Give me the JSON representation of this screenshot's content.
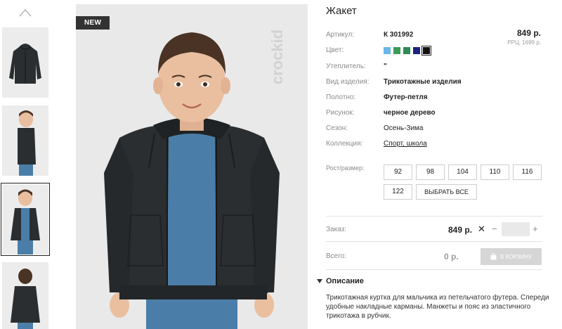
{
  "product": {
    "title": "Жакет",
    "badge": "NEW",
    "watermark": "crockid",
    "price": "849 р.",
    "rrp": "РРЦ: 1699 р."
  },
  "attributes": [
    {
      "label": "Артикул:",
      "value": "К 301992"
    },
    {
      "label": "Цвет:",
      "value": ""
    },
    {
      "label": "Утеплитель:",
      "value": "\""
    },
    {
      "label": "Вид изделия:",
      "value": "Трикотажные изделия"
    },
    {
      "label": "Полотно:",
      "value": "Футер-петля"
    },
    {
      "label": "Рисунок:",
      "value": "черное дерево"
    },
    {
      "label": "Сезон:",
      "value": "Осень-Зима"
    },
    {
      "label": "Коллекция:",
      "value": "Спорт, школа"
    }
  ],
  "swatch_colors": [
    "#6ab7e8",
    "#3d9a58",
    "#2f8a55",
    "#1b237e",
    "#111111"
  ],
  "selected_swatch_index": 4,
  "sizes": {
    "label": "Рост/размер:",
    "options": [
      "92",
      "98",
      "104",
      "110",
      "116",
      "122"
    ],
    "select_all": "ВЫБРАТЬ ВСЕ"
  },
  "order": {
    "label": "Заказ:",
    "price": "849 р.",
    "times": "✕",
    "minus": "−",
    "plus": "+",
    "qty": ""
  },
  "total": {
    "label": "Всего:",
    "value": "0 р.",
    "cart_button": "В КОРЗИНУ"
  },
  "description": {
    "heading": "Описание",
    "text": "Трикотажная куртка для мальчика из петельчатого футера. Спереди удобные накладные карманы. Манжеты и пояс из эластичного трикотажа в рубчик."
  },
  "colors": {
    "jacket": "#2b2e30",
    "tshirt": "#4a7ea8",
    "skin": "#e9bfa0",
    "hair": "#4a3324"
  }
}
